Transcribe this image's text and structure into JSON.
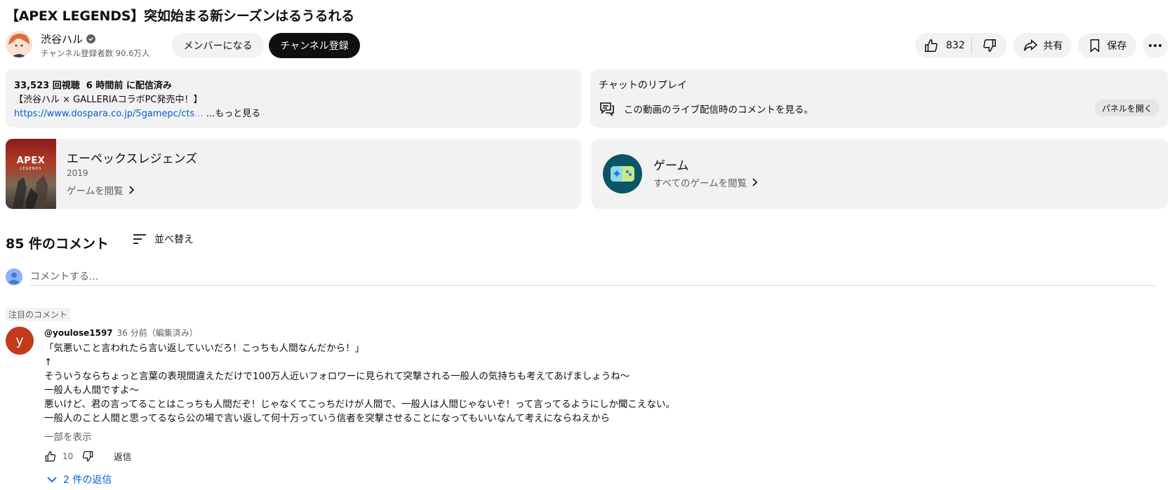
{
  "video": {
    "title": "【APEX LEGENDS】突如始まる新シーズンはるうるれる"
  },
  "channel": {
    "name": "渋谷ハル",
    "subscribers": "チャンネル登録者数 90.6万人",
    "join_label": "メンバーになる",
    "subscribe_label": "チャンネル登録"
  },
  "actions": {
    "like_count": "832",
    "share_label": "共有",
    "save_label": "保存"
  },
  "description": {
    "views": "33,523 回視聴",
    "time": "6 時間前 に配信済み",
    "line1": "【渋谷ハル × GALLERIAコラボPC発売中！】",
    "link": "https://www.dospara.co.jp/5gamepc/cts",
    "link_fade": "...",
    "more": "...もっと見る"
  },
  "chat_replay": {
    "title": "チャットのリプレイ",
    "text": "この動画のライブ配信時のコメントを見る。",
    "button": "パネルを開く"
  },
  "game": {
    "cover_title": "APEX",
    "cover_sub": "LEGENDS",
    "name": "エーペックスレジェンズ",
    "year": "2019",
    "browse": "ゲームを閲覧"
  },
  "gaming": {
    "name": "ゲーム",
    "browse": "すべてのゲームを閲覧"
  },
  "comments": {
    "count_label": "85 件のコメント",
    "sort_label": "並べ替え",
    "input_placeholder": "コメントする..."
  },
  "featured_comment": {
    "badge": "注目のコメント",
    "avatar_letter": "y",
    "author": "@youlose1597",
    "time": "36 分前（編集済み）",
    "lines": [
      "「気悪いこと言われたら言い返していいだろ！こっちも人間なんだから！」",
      "↑",
      "そういうならちょっと言葉の表現間違えただけで100万人近いフォロワーに見られて突撃される一般人の気持ちも考えてあげましょうね～",
      "一般人も人間ですよ～",
      "悪いけど、君の言ってることはこっちも人間だぞ！じゃなくてこっちだけが人間で、一般人は人間じゃないぞ！って言ってるようにしか聞こえない。",
      "一般人のこと人間と思ってるなら公の場で言い返して何十万っていう信者を突撃させることになってもいいなんて考えにならねえから"
    ],
    "show_part": "一部を表示",
    "likes": "10",
    "reply_label": "返信",
    "replies_label": "2 件の返信"
  }
}
